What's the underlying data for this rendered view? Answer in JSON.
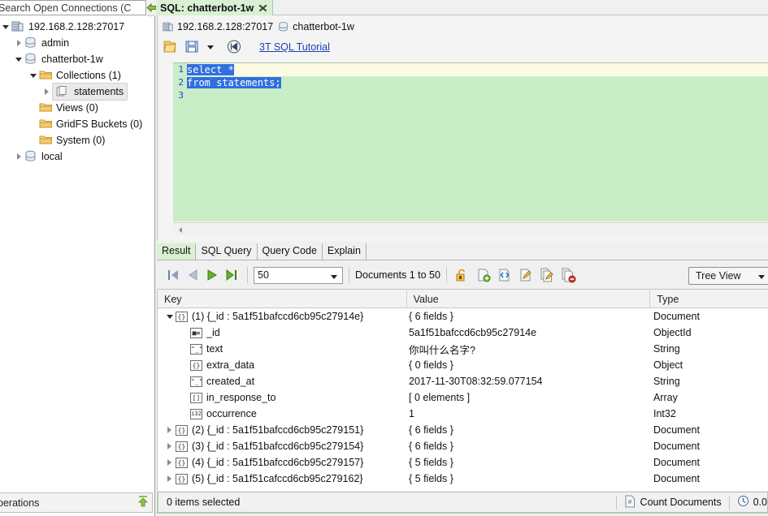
{
  "left_panel": {
    "search": {
      "placeholder": "Search Open Connections (C",
      "icon": "search-icon"
    },
    "tree": [
      {
        "label": "192.168.2.128:27017",
        "icon": "server-icon",
        "indent": 0,
        "state": "expanded"
      },
      {
        "label": "admin",
        "icon": "database-icon",
        "indent": 1,
        "state": "collapsed"
      },
      {
        "label": "chatterbot-1w",
        "icon": "database-icon",
        "indent": 1,
        "state": "expanded"
      },
      {
        "label": "Collections (1)",
        "icon": "folder-icon",
        "indent": 2,
        "state": "expanded"
      },
      {
        "label": "statements",
        "icon": "collection-icon",
        "indent": 3,
        "state": "collapsed",
        "selected": true
      },
      {
        "label": "Views (0)",
        "icon": "folder-icon",
        "indent": 2,
        "state": "leaf"
      },
      {
        "label": "GridFS Buckets (0)",
        "icon": "folder-icon",
        "indent": 2,
        "state": "leaf"
      },
      {
        "label": "System (0)",
        "icon": "folder-icon",
        "indent": 2,
        "state": "leaf"
      },
      {
        "label": "local",
        "icon": "database-icon",
        "indent": 1,
        "state": "collapsed"
      }
    ],
    "operations_bar": {
      "label": "perations",
      "icon": "collapse-up-icon"
    }
  },
  "main": {
    "tab": {
      "label": "SQL: chatterbot-1w",
      "close_icon": "close-icon"
    },
    "breadcrumb": {
      "server_icon": "server-icon",
      "server": "192.168.2.128:27017",
      "db_icon": "database-icon",
      "database": "chatterbot-1w"
    },
    "editor_toolbar": {
      "buttons": [
        {
          "name": "open-file-icon",
          "label": ""
        },
        {
          "name": "save-icon",
          "label": ""
        },
        {
          "name": "save-dropdown-icon",
          "label": ""
        },
        {
          "name": "execute-icon",
          "label": ""
        }
      ],
      "tutorial_link": "3T SQL Tutorial"
    },
    "editor": {
      "background_color": "#c9edc6",
      "current_line_color": "#fdfae3",
      "selection_color": "#2f6fe0",
      "lines": [
        {
          "number": "1",
          "text": "select *",
          "selected_text": "select *",
          "current": true
        },
        {
          "number": "2",
          "text": "from statements;",
          "selected_text": "from statements;",
          "current": false
        },
        {
          "number": "3",
          "text": "",
          "selected_text": "",
          "current": false
        }
      ],
      "hscroll_icon": "scroll-left-icon"
    },
    "result_tabs": [
      {
        "label": "Result",
        "active": true
      },
      {
        "label": "SQL Query",
        "active": false
      },
      {
        "label": "Query Code",
        "active": false
      },
      {
        "label": "Explain",
        "active": false
      }
    ],
    "result_toolbar": {
      "nav": [
        {
          "name": "first-page-button",
          "icon": "skip-first-icon",
          "enabled": false
        },
        {
          "name": "prev-page-button",
          "icon": "prev-icon",
          "enabled": false
        },
        {
          "name": "next-page-button",
          "icon": "next-icon",
          "enabled": true
        },
        {
          "name": "last-page-button",
          "icon": "skip-last-icon",
          "enabled": true
        }
      ],
      "page_size": "50",
      "documents_range": "Documents 1 to 50",
      "actions": [
        {
          "name": "unlock-icon"
        },
        {
          "name": "add-document-icon"
        },
        {
          "name": "view-json-icon"
        },
        {
          "name": "edit-document-icon"
        },
        {
          "name": "copy-document-icon"
        },
        {
          "name": "delete-document-icon"
        }
      ],
      "view_mode": "Tree View"
    },
    "result_table": {
      "columns": [
        "Key",
        "Value",
        "Type"
      ],
      "rows": [
        {
          "indent": 0,
          "twist": "expanded",
          "icon": "document-icon",
          "key": "(1) {_id : 5a1f51bafccd6cb95c27914e}",
          "value": "{ 6 fields }",
          "type": "Document"
        },
        {
          "indent": 1,
          "twist": "none",
          "icon": "objectid-icon",
          "key": "_id",
          "value": "5a1f51bafccd6cb95c27914e",
          "type": "ObjectId"
        },
        {
          "indent": 1,
          "twist": "none",
          "icon": "string-icon",
          "key": "text",
          "value": "你叫什么名字?",
          "type": "String"
        },
        {
          "indent": 1,
          "twist": "collapsed-hidden",
          "icon": "object-icon",
          "key": "extra_data",
          "value": "{ 0 fields }",
          "type": "Object"
        },
        {
          "indent": 1,
          "twist": "none",
          "icon": "string-icon",
          "key": "created_at",
          "value": "2017-11-30T08:32:59.077154",
          "type": "String"
        },
        {
          "indent": 1,
          "twist": "none",
          "icon": "array-icon",
          "key": "in_response_to",
          "value": "[ 0 elements ]",
          "type": "Array"
        },
        {
          "indent": 1,
          "twist": "none",
          "icon": "int32-icon",
          "key": "occurrence",
          "value": "1",
          "type": "Int32"
        },
        {
          "indent": 0,
          "twist": "collapsed",
          "icon": "document-icon",
          "key": "(2) {_id : 5a1f51bafccd6cb95c279151}",
          "value": "{ 6 fields }",
          "type": "Document"
        },
        {
          "indent": 0,
          "twist": "collapsed",
          "icon": "document-icon",
          "key": "(3) {_id : 5a1f51bafccd6cb95c279154}",
          "value": "{ 6 fields }",
          "type": "Document"
        },
        {
          "indent": 0,
          "twist": "collapsed",
          "icon": "document-icon",
          "key": "(4) {_id : 5a1f51bafccd6cb95c279157}",
          "value": "{ 5 fields }",
          "type": "Document"
        },
        {
          "indent": 0,
          "twist": "collapsed",
          "icon": "document-icon",
          "key": "(5) {_id : 5a1f51cafccd6cb95c279162}",
          "value": "{ 5 fields }",
          "type": "Document"
        }
      ]
    },
    "status_bar": {
      "selection": "0 items selected",
      "count_documents": {
        "label": "Count Documents",
        "icon": "count-documents-icon"
      },
      "timing": {
        "label": "0.0",
        "icon": "clock-icon"
      }
    }
  }
}
